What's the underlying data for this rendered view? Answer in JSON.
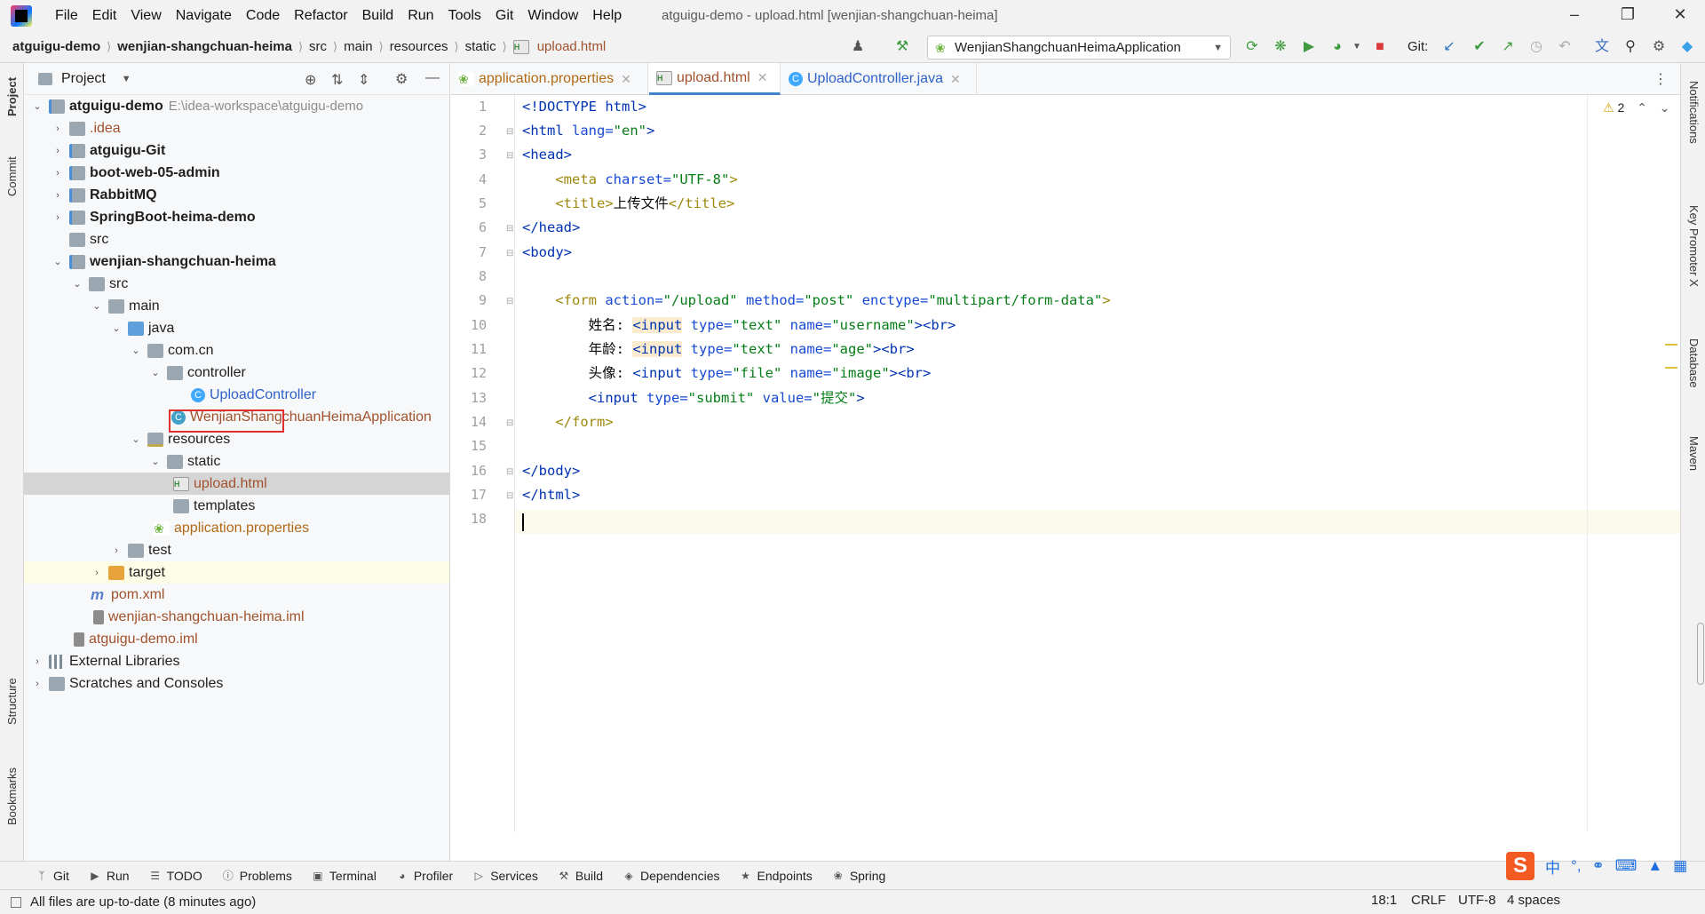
{
  "menu": [
    "File",
    "Edit",
    "View",
    "Navigate",
    "Code",
    "Refactor",
    "Build",
    "Run",
    "Tools",
    "Git",
    "Window",
    "Help"
  ],
  "window_title": "atguigu-demo - upload.html [wenjian-shangchuan-heima]",
  "breadcrumbs": [
    "atguigu-demo",
    "wenjian-shangchuan-heima",
    "src",
    "main",
    "resources",
    "static",
    "upload.html"
  ],
  "run_config": "WenjianShangchuanHeimaApplication",
  "git_label": "Git:",
  "project_panel": {
    "title": "Project",
    "rows": [
      {
        "label": "atguigu-demo",
        "extra": "E:\\idea-workspace\\atguigu-demo"
      },
      {
        "label": ".idea"
      },
      {
        "label": "atguigu-Git"
      },
      {
        "label": "boot-web-05-admin"
      },
      {
        "label": "RabbitMQ"
      },
      {
        "label": "SpringBoot-heima-demo"
      },
      {
        "label": "src"
      },
      {
        "label": "wenjian-shangchuan-heima"
      },
      {
        "label": "src"
      },
      {
        "label": "main"
      },
      {
        "label": "java"
      },
      {
        "label": "com.cn"
      },
      {
        "label": "controller"
      },
      {
        "label": "UploadController"
      },
      {
        "label": "WenjianShangchuanHeimaApplication"
      },
      {
        "label": "resources"
      },
      {
        "label": "static"
      },
      {
        "label": "upload.html"
      },
      {
        "label": "templates"
      },
      {
        "label": "application.properties"
      },
      {
        "label": "test"
      },
      {
        "label": "target"
      },
      {
        "label": "pom.xml"
      },
      {
        "label": "wenjian-shangchuan-heima.iml"
      },
      {
        "label": "atguigu-demo.iml"
      },
      {
        "label": "External Libraries"
      },
      {
        "label": "Scratches and Consoles"
      }
    ]
  },
  "left_stripe": [
    "Project",
    "Commit",
    "Structure",
    "Bookmarks"
  ],
  "right_stripe": [
    "Notifications",
    "Key Promoter X",
    "Database",
    "Maven"
  ],
  "tabs": [
    {
      "label": "application.properties"
    },
    {
      "label": "upload.html"
    },
    {
      "label": "UploadController.java"
    }
  ],
  "warnings": "2",
  "code": {
    "line_numbers": [
      "1",
      "2",
      "3",
      "4",
      "5",
      "6",
      "7",
      "8",
      "9",
      "10",
      "11",
      "12",
      "13",
      "14",
      "15",
      "16",
      "17",
      "18"
    ],
    "l1": "<!DOCTYPE html>",
    "l2_tag": "<html ",
    "l2_attr": "lang=",
    "l2_val": "\"en\"",
    "l2_end": ">",
    "l3": "<head>",
    "l4_tag": "<meta ",
    "l4_attr": "charset=",
    "l4_val": "\"UTF-8\"",
    "l4_end": ">",
    "l5_open": "<title>",
    "l5_text": "上传文件",
    "l5_close": "</title>",
    "l6": "</head>",
    "l7": "<body>",
    "l9_tag": "<form ",
    "l9_a1": "action=",
    "l9_v1": "\"/upload\"",
    "l9_a2": " method=",
    "l9_v2": "\"post\"",
    "l9_a3": " enctype=",
    "l9_v3": "\"multipart/form-data\"",
    "l9_end": ">",
    "l10_text": "姓名: ",
    "l10_tag": "<input",
    "l10_a1": " type=",
    "l10_v1": "\"text\"",
    "l10_a2": " name=",
    "l10_v2": "\"username\"",
    "l10_end": "><br>",
    "l11_text": "年龄: ",
    "l11_tag": "<input",
    "l11_a1": " type=",
    "l11_v1": "\"text\"",
    "l11_a2": " name=",
    "l11_v2": "\"age\"",
    "l11_end": "><br>",
    "l12_text": "头像: ",
    "l12_tag": "<input",
    "l12_a1": " type=",
    "l12_v1": "\"file\"",
    "l12_a2": " name=",
    "l12_v2": "\"image\"",
    "l12_end": "><br>",
    "l13_tag": "<input",
    "l13_a1": " type=",
    "l13_v1": "\"submit\"",
    "l13_a2": " value=",
    "l13_v2": "\"提交\"",
    "l13_end": ">",
    "l14": "</form>",
    "l16": "</body>",
    "l17": "</html>"
  },
  "toolwindows": [
    "Git",
    "Run",
    "TODO",
    "Problems",
    "Terminal",
    "Profiler",
    "Services",
    "Build",
    "Dependencies",
    "Endpoints",
    "Spring"
  ],
  "status": {
    "message": "All files are up-to-date (8 minutes ago)",
    "position": "18:1",
    "line_sep": "CRLF",
    "encoding": "UTF-8",
    "indent": "4 spaces"
  },
  "ime_label": "中"
}
